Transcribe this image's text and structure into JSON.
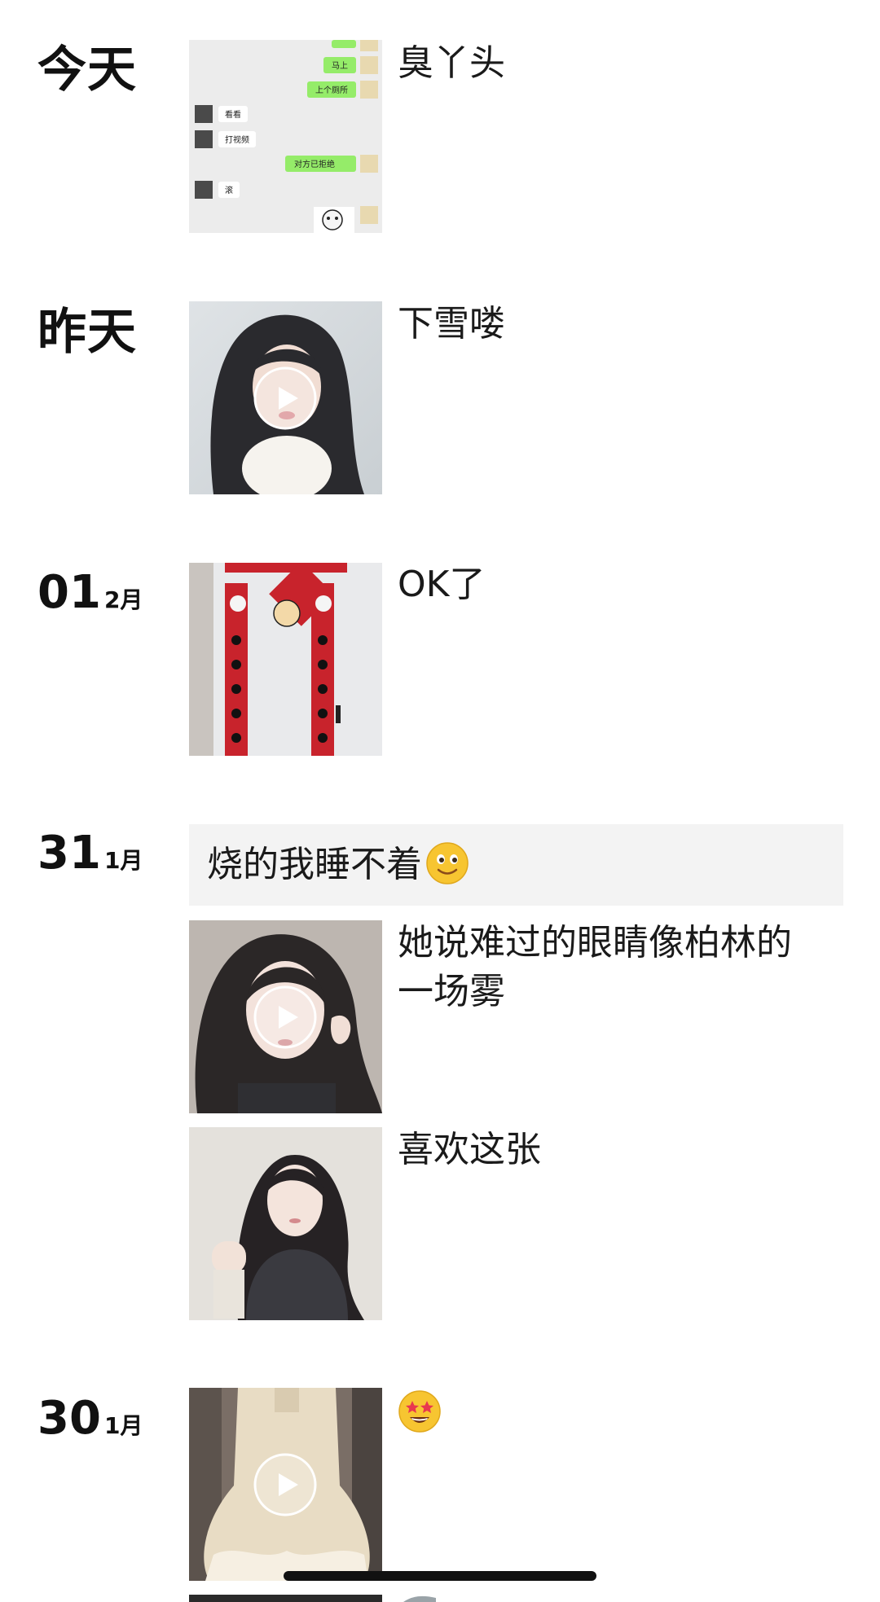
{
  "posts": [
    {
      "day_label": "今天",
      "caption": "臭丫头",
      "media": "chat-screenshot",
      "chat": {
        "bubbles": [
          "马上",
          "上个厕所",
          "看看",
          "打视频",
          "对方已拒绝",
          "滚"
        ]
      }
    },
    {
      "day_label": "昨天",
      "caption": "下雪喽",
      "media": "video"
    },
    {
      "day_num": "01",
      "month": "2月",
      "caption": "OK了",
      "media": "photo"
    },
    {
      "day_num": "31",
      "month": "1月",
      "text_post": "烧的我睡不着",
      "items": [
        {
          "caption": "她说难过的眼睛像柏林的一场雾",
          "media": "video"
        },
        {
          "caption": "喜欢这张",
          "media": "photo"
        }
      ]
    },
    {
      "day_num": "30",
      "month": "1月",
      "caption_emoji": "star-struck-emoji-icon",
      "media": "video"
    }
  ],
  "colors": {
    "chat_bubble_green": "#95ec69",
    "text_post_bg": "#f3f3f3",
    "emoji_yellow": "#f7c531"
  }
}
